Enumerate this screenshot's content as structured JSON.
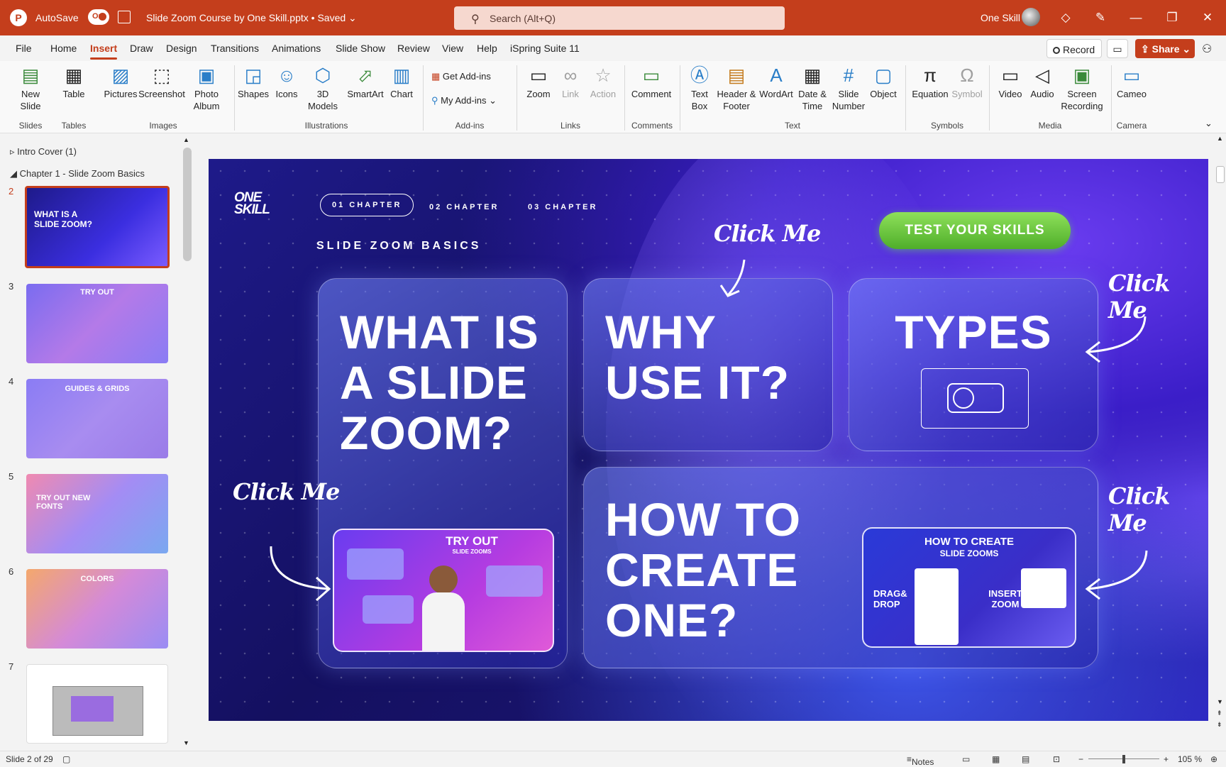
{
  "titlebar": {
    "autosave": "AutoSave",
    "toggle": "On",
    "doc_title": "Slide Zoom Course by One Skill.pptx • Saved",
    "search_placeholder": "Search (Alt+Q)",
    "user": "One Skill"
  },
  "menu": {
    "tabs": [
      "File",
      "Home",
      "Insert",
      "Draw",
      "Design",
      "Transitions",
      "Animations",
      "Slide Show",
      "Review",
      "View",
      "Help",
      "iSpring Suite 11"
    ],
    "active": "Insert",
    "record": "Record",
    "share": "Share"
  },
  "ribbon": {
    "buttons": {
      "new_slide": "New Slide",
      "table": "Table",
      "pictures": "Pictures",
      "screenshot": "Screenshot",
      "photo_album": "Photo Album",
      "shapes": "Shapes",
      "icons": "Icons",
      "models": "3D Models",
      "smartart": "SmartArt",
      "chart": "Chart",
      "get_addins": "Get Add-ins",
      "my_addins": "My Add-ins",
      "zoom": "Zoom",
      "link": "Link",
      "action": "Action",
      "comment": "Comment",
      "text_box": "Text Box",
      "header_footer": "Header & Footer",
      "wordart": "WordArt",
      "date_time": "Date & Time",
      "slide_number": "Slide Number",
      "object": "Object",
      "equation": "Equation",
      "symbol": "Symbol",
      "video": "Video",
      "audio": "Audio",
      "screen_recording": "Screen Recording",
      "cameo": "Cameo"
    },
    "groups": [
      "Slides",
      "Tables",
      "Images",
      "Illustrations",
      "Add-ins",
      "Links",
      "Comments",
      "Text",
      "Symbols",
      "Media",
      "Camera"
    ]
  },
  "pane": {
    "sections": [
      "Intro Cover (1)",
      "Chapter 1 - Slide Zoom Basics"
    ],
    "thumbs": [
      {
        "num": "2",
        "text": "WHAT IS A SLIDE ZOOM?"
      },
      {
        "num": "3",
        "text": "TRY OUT"
      },
      {
        "num": "4",
        "text": "GUIDES & GRIDS"
      },
      {
        "num": "5",
        "text": "TRY OUT NEW FONTS"
      },
      {
        "num": "6",
        "text": "COLORS"
      },
      {
        "num": "7",
        "text": ""
      }
    ]
  },
  "slide": {
    "logo_line1": "ONE",
    "logo_line2": "SKILL",
    "chapters": [
      "01 CHAPTER",
      "02 CHAPTER",
      "03 CHAPTER"
    ],
    "title": "SLIDE ZOOM BASICS",
    "test_btn": "TEST YOUR SKILLS",
    "cards": {
      "what": "WHAT IS A SLIDE ZOOM?",
      "why": "WHY USE IT?",
      "types": "TYPES",
      "how": "HOW TO CREATE ONE?"
    },
    "click_me": "Click Me",
    "mini_try": "TRY OUT",
    "mini_try_sub": "SLIDE ZOOMS",
    "mini_how": "HOW TO CREATE",
    "mini_how_sub": "SLIDE ZOOMS",
    "mini_opt1": "DRAG& DROP",
    "mini_opt2": "INSERT ZOOM"
  },
  "status": {
    "slide_count": "Slide 2 of 29",
    "notes": "Notes",
    "zoom": "105 %"
  },
  "colors": {
    "accent": "#c43e1c",
    "test_btn": "#6cc63d"
  }
}
